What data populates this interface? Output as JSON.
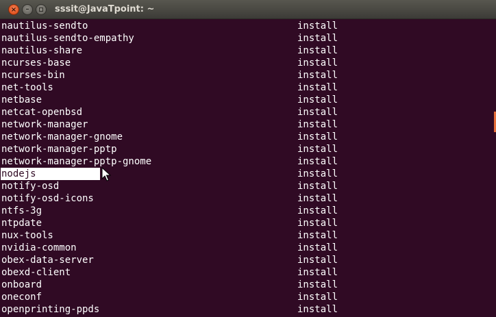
{
  "window": {
    "title": "sssit@JavaTpoint: ~",
    "buttons": {
      "close_glyph": "×",
      "minimize_glyph": "–"
    }
  },
  "terminal": {
    "rows": [
      {
        "package": "nautilus-sendto",
        "action": "install"
      },
      {
        "package": "nautilus-sendto-empathy",
        "action": "install"
      },
      {
        "package": "nautilus-share",
        "action": "install"
      },
      {
        "package": "ncurses-base",
        "action": "install"
      },
      {
        "package": "ncurses-bin",
        "action": "install"
      },
      {
        "package": "net-tools",
        "action": "install"
      },
      {
        "package": "netbase",
        "action": "install"
      },
      {
        "package": "netcat-openbsd",
        "action": "install"
      },
      {
        "package": "network-manager",
        "action": "install"
      },
      {
        "package": "network-manager-gnome",
        "action": "install"
      },
      {
        "package": "network-manager-pptp",
        "action": "install"
      },
      {
        "package": "network-manager-pptp-gnome",
        "action": "install"
      },
      {
        "package": "nodejs",
        "action": "install",
        "selected": true
      },
      {
        "package": "notify-osd",
        "action": "install"
      },
      {
        "package": "notify-osd-icons",
        "action": "install"
      },
      {
        "package": "ntfs-3g",
        "action": "install"
      },
      {
        "package": "ntpdate",
        "action": "install"
      },
      {
        "package": "nux-tools",
        "action": "install"
      },
      {
        "package": "nvidia-common",
        "action": "install"
      },
      {
        "package": "obex-data-server",
        "action": "install"
      },
      {
        "package": "obexd-client",
        "action": "install"
      },
      {
        "package": "onboard",
        "action": "install"
      },
      {
        "package": "oneconf",
        "action": "install"
      },
      {
        "package": "openprinting-ppds",
        "action": "install"
      }
    ]
  },
  "colors": {
    "terminal_background": "#300a24",
    "text": "#ffffff",
    "scroll_thumb": "#e46e3a",
    "close_button": "#e0531f"
  },
  "icons": {
    "close": "close-icon",
    "minimize": "minimize-icon",
    "maximize": "maximize-icon",
    "cursor": "mouse-pointer-icon"
  }
}
